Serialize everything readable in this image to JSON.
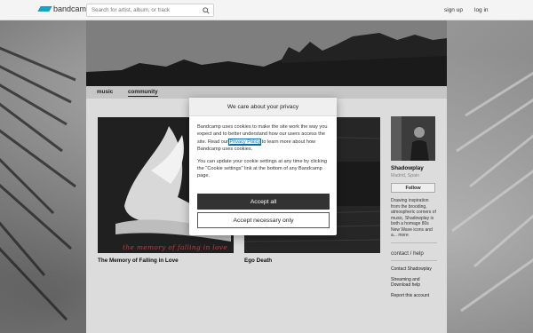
{
  "header": {
    "logo_text": "bandcamp",
    "search_placeholder": "Search for artist, album, or track",
    "signup_label": "sign up",
    "login_label": "log in"
  },
  "tabs": [
    {
      "label": "music"
    },
    {
      "label": "community"
    }
  ],
  "albums": [
    {
      "title": "The Memory of Falling in Love",
      "cover_text": "the memory of falling in love"
    },
    {
      "title": "Ego Death"
    }
  ],
  "artist": {
    "name": "Shadowplay",
    "location": "Madrid, Spain",
    "follow_label": "Follow",
    "bio": "Drawing inspiration from the brooding, atmospheric corners of music, Shadowplay is both a homage 80s New Wave icons and a...",
    "more_label": "more",
    "contact_heading": "contact / help",
    "links": [
      "Contact Shadowplay",
      "Streaming and Download help",
      "Report this account"
    ]
  },
  "privacy_modal": {
    "title": "We care about your privacy",
    "para1_before": "Bandcamp uses cookies to make the site work the way you expect and to better understand how our users access the site. Read our ",
    "privacy_link": "Privacy Policy",
    "para1_after": " to learn more about how Bandcamp uses cookies.",
    "para2": "You can update your cookie settings at any time by clicking the \"Cookie settings\" link at the bottom of any Bandcamp page.",
    "accept_all_label": "Accept all",
    "accept_necessary_label": "Accept necessary only"
  },
  "colors": {
    "logo_accent": "#1da0c3",
    "modal_primary_button": "#333333",
    "link_blue": "#0b6ba8"
  }
}
